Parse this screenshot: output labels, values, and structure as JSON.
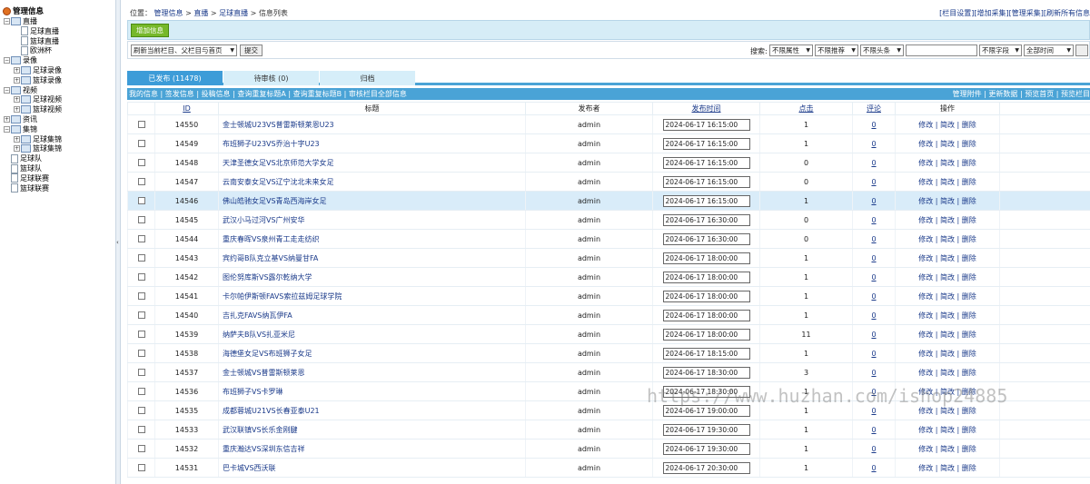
{
  "sidebar": {
    "root": "管理信息",
    "nodes": [
      {
        "label": "直播",
        "type": "folder",
        "level": 0,
        "toggle": "−"
      },
      {
        "label": "足球直播",
        "type": "doc",
        "level": 1
      },
      {
        "label": "篮球直播",
        "type": "doc",
        "level": 1
      },
      {
        "label": "欧洲杯",
        "type": "doc",
        "level": 1
      },
      {
        "label": "录像",
        "type": "folder",
        "level": 0,
        "toggle": "−"
      },
      {
        "label": "足球录像",
        "type": "folder",
        "level": 1,
        "toggle": "+"
      },
      {
        "label": "篮球录像",
        "type": "folder",
        "level": 1,
        "toggle": "+"
      },
      {
        "label": "视频",
        "type": "folder",
        "level": 0,
        "toggle": "−"
      },
      {
        "label": "足球视频",
        "type": "folder",
        "level": 1,
        "toggle": "+"
      },
      {
        "label": "篮球视频",
        "type": "folder",
        "level": 1,
        "toggle": "+"
      },
      {
        "label": "资讯",
        "type": "folder",
        "level": 0,
        "toggle": "+"
      },
      {
        "label": "集锦",
        "type": "folder",
        "level": 0,
        "toggle": "−"
      },
      {
        "label": "足球集锦",
        "type": "folder",
        "level": 1,
        "toggle": "+"
      },
      {
        "label": "篮球集锦",
        "type": "folder",
        "level": 1,
        "toggle": "+"
      },
      {
        "label": "足球队",
        "type": "doc",
        "level": 0
      },
      {
        "label": "篮球队",
        "type": "doc",
        "level": 0
      },
      {
        "label": "足球联赛",
        "type": "doc",
        "level": 0
      },
      {
        "label": "篮球联赛",
        "type": "doc",
        "level": 0
      }
    ],
    "collapse_arrow": "‹"
  },
  "breadcrumb": {
    "prefix": "位置：",
    "items": [
      "管理信息",
      "直播",
      "足球直播"
    ],
    "sep": " > ",
    "current": "信息列表"
  },
  "toplinks": [
    "[栏目设置]",
    "[增加采集]",
    "[管理采集]",
    "[刷新所有信息"
  ],
  "toolbar": {
    "add_label": "增加信息"
  },
  "filter": {
    "refresh_select": "刷新当前栏目、父栏目与首页",
    "submit": "提交",
    "search_label": "搜索:",
    "attr": "不限属性",
    "rec": "不限推荐",
    "head": "不限头条",
    "field": "不限字段",
    "time": "全部时间"
  },
  "tabs": [
    "已发布 (11478)",
    "待审核 (0)",
    "归档"
  ],
  "linkbar": {
    "left": "我的信息 | 签发信息 | 投稿信息 | 查询重复标题A | 查询重复标题B | 审核栏目全部信息",
    "right": "管理附件 | 更新数据 | 预览首页 | 预览栏目"
  },
  "table": {
    "headers": {
      "id": "ID",
      "title": "标题",
      "publisher": "发布者",
      "time": "发布时间",
      "clicks": "点击",
      "comments": "评论",
      "ops": "操作"
    },
    "ops_text": "修改 | 简改 | 删除",
    "highlight_row": 4,
    "rows": [
      {
        "id": "14550",
        "title": "金士顿城U23VS普雷斯顿莱恩U23",
        "pub": "admin",
        "time": "2024-06-17 16:15:00",
        "clicks": "1",
        "comments": "0"
      },
      {
        "id": "14549",
        "title": "布班狮子U23VS乔治十字U23",
        "pub": "admin",
        "time": "2024-06-17 16:15:00",
        "clicks": "1",
        "comments": "0"
      },
      {
        "id": "14548",
        "title": "天津圣德女足VS北京师范大学女足",
        "pub": "admin",
        "time": "2024-06-17 16:15:00",
        "clicks": "0",
        "comments": "0"
      },
      {
        "id": "14547",
        "title": "云南安泰女足VS辽宁沈北未来女足",
        "pub": "admin",
        "time": "2024-06-17 16:15:00",
        "clicks": "0",
        "comments": "0"
      },
      {
        "id": "14546",
        "title": "佛山皓驰女足VS青岛西海岸女足",
        "pub": "admin",
        "time": "2024-06-17 16:15:00",
        "clicks": "1",
        "comments": "0"
      },
      {
        "id": "14545",
        "title": "武汉小马过河VS广州安华",
        "pub": "admin",
        "time": "2024-06-17 16:30:00",
        "clicks": "0",
        "comments": "0"
      },
      {
        "id": "14544",
        "title": "重庆春晖VS泉州青工走走纺织",
        "pub": "admin",
        "time": "2024-06-17 16:30:00",
        "clicks": "0",
        "comments": "0"
      },
      {
        "id": "14543",
        "title": "宾约哥B队克立基VS纳曼甘FA",
        "pub": "admin",
        "time": "2024-06-17 18:00:00",
        "clicks": "1",
        "comments": "0"
      },
      {
        "id": "14542",
        "title": "图伦努库斯VS露尔乾纳大学",
        "pub": "admin",
        "time": "2024-06-17 18:00:00",
        "clicks": "1",
        "comments": "0"
      },
      {
        "id": "14541",
        "title": "卡尔帕伊斯顿FAVS索拉兹姆足球学院",
        "pub": "admin",
        "time": "2024-06-17 18:00:00",
        "clicks": "1",
        "comments": "0"
      },
      {
        "id": "14540",
        "title": "吉扎克FAVS纳瓦伊FA",
        "pub": "admin",
        "time": "2024-06-17 18:00:00",
        "clicks": "1",
        "comments": "0"
      },
      {
        "id": "14539",
        "title": "纳萨夫B队VS扎亚米尼",
        "pub": "admin",
        "time": "2024-06-17 18:00:00",
        "clicks": "11",
        "comments": "0"
      },
      {
        "id": "14538",
        "title": "海德堡女足VS布班狮子女足",
        "pub": "admin",
        "time": "2024-06-17 18:15:00",
        "clicks": "1",
        "comments": "0"
      },
      {
        "id": "14537",
        "title": "金士顿城VS普雷斯顿莱恩",
        "pub": "admin",
        "time": "2024-06-17 18:30:00",
        "clicks": "3",
        "comments": "0"
      },
      {
        "id": "14536",
        "title": "布班狮子VS卡罗琳",
        "pub": "admin",
        "time": "2024-06-17 18:30:00",
        "clicks": "1",
        "comments": "0"
      },
      {
        "id": "14535",
        "title": "成都蓉城U21VS长春亚泰U21",
        "pub": "admin",
        "time": "2024-06-17 19:00:00",
        "clicks": "1",
        "comments": "0"
      },
      {
        "id": "14533",
        "title": "武汉联镇VS长乐金刚腱",
        "pub": "admin",
        "time": "2024-06-17 19:30:00",
        "clicks": "1",
        "comments": "0"
      },
      {
        "id": "14532",
        "title": "重庆瀚达VS深圳东信吉祥",
        "pub": "admin",
        "time": "2024-06-17 19:30:00",
        "clicks": "1",
        "comments": "0"
      },
      {
        "id": "14531",
        "title": "巴卡城VS西沃联",
        "pub": "admin",
        "time": "2024-06-17 20:30:00",
        "clicks": "1",
        "comments": "0"
      }
    ]
  },
  "watermark": "https://www.huzhan.com/ishop24885"
}
